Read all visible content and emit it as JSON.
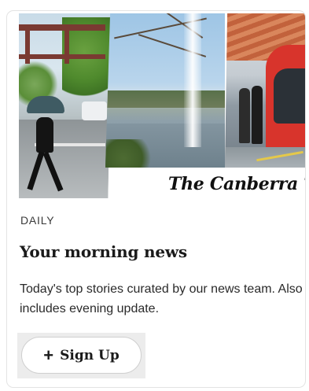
{
  "hero": {
    "masthead": "The Canberra Tim"
  },
  "newsletter": {
    "category": "DAILY",
    "title": "Your morning news",
    "description": "Today's top stories curated by our news team. Also includes evening update.",
    "signup_label": "Sign Up",
    "signup_icon": "plus-icon"
  }
}
